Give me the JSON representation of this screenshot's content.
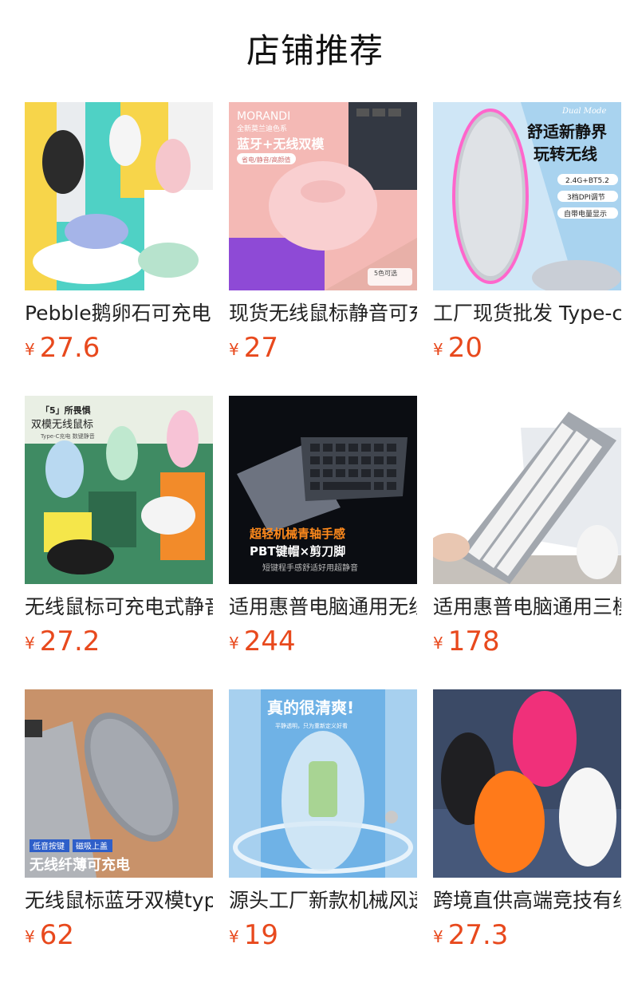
{
  "section": {
    "title": "店铺推荐"
  },
  "currency_symbol": "¥",
  "products": [
    {
      "name": "Pebble鹅卵石可充电",
      "price": "27.6",
      "overlay": []
    },
    {
      "name": "现货无线鼠标静音可充电",
      "price": "27",
      "overlay": [
        "MORANDI",
        "全新莫兰迪色系",
        "蓝牙+无线双模",
        "省电/静音/高颜值",
        "5色可选"
      ]
    },
    {
      "name": "工厂现货批发 Type-c",
      "price": "20",
      "overlay": [
        "Dual Mode",
        "舒适新静界",
        "玩转无线",
        "2.4G+BT5.2",
        "3档DPI调节",
        "自带电量显示"
      ]
    },
    {
      "name": "无线鼠标可充电式静音",
      "price": "27.2",
      "overlay": [
        "「5」所畏惧",
        "双模无线鼠标",
        "Type-C充电 数键静音"
      ]
    },
    {
      "name": "适用惠普电脑通用无线",
      "price": "244",
      "overlay": [
        "超轻机械青轴手感",
        "PBT键帽×剪刀脚",
        "短键程手感舒适好用超静音"
      ]
    },
    {
      "name": "适用惠普电脑通用三模",
      "price": "178",
      "overlay": []
    },
    {
      "name": "无线鼠标蓝牙双模type",
      "price": "62",
      "overlay": [
        "低音按键",
        "磁吸上盖",
        "无线纤薄可充电"
      ]
    },
    {
      "name": "源头工厂新款机械风透明",
      "price": "19",
      "overlay": [
        "真的很清爽!",
        "平静透明，只为重新定义好看"
      ]
    },
    {
      "name": "跨境直供高端竞技有线",
      "price": "27.3",
      "overlay": []
    }
  ],
  "icons": {
    "mouse": "mouse-icon",
    "keyboard": "keyboard-icon"
  }
}
